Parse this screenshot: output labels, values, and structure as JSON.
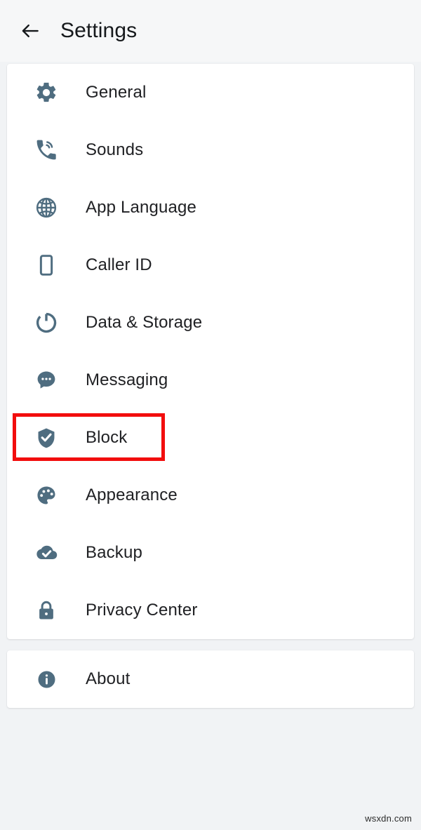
{
  "appbar": {
    "back_icon": "arrow-left-icon",
    "title": "Settings"
  },
  "colors": {
    "page_background": "#f1f3f5",
    "card_background": "#ffffff",
    "icon": "#4f6d80",
    "label_text": "#202124",
    "title_text": "#16191c",
    "highlight_border": "#f20d0d"
  },
  "settings_card": {
    "items": [
      {
        "label": "General",
        "icon": "gear-icon"
      },
      {
        "label": "Sounds",
        "icon": "phone-ring-icon"
      },
      {
        "label": "App Language",
        "icon": "globe-icon"
      },
      {
        "label": "Caller ID",
        "icon": "smartphone-icon"
      },
      {
        "label": "Data & Storage",
        "icon": "storage-ring-icon"
      },
      {
        "label": "Messaging",
        "icon": "chat-bubble-icon"
      },
      {
        "label": "Block",
        "icon": "shield-check-icon"
      },
      {
        "label": "Appearance",
        "icon": "palette-icon"
      },
      {
        "label": "Backup",
        "icon": "cloud-check-icon"
      },
      {
        "label": "Privacy Center",
        "icon": "lock-icon"
      }
    ]
  },
  "about_card": {
    "items": [
      {
        "label": "About",
        "icon": "info-circle-icon"
      }
    ]
  },
  "annotation": {
    "highlighted_item": "Block"
  },
  "watermark": {
    "text": "wsxdn.com"
  }
}
